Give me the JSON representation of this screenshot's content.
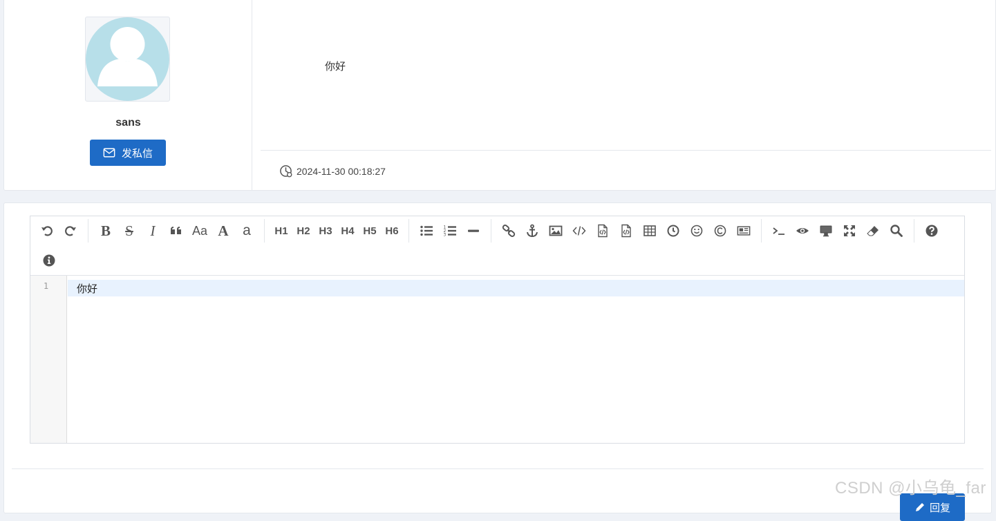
{
  "post": {
    "author": {
      "name": "sans",
      "avatar_icon": "default-user-avatar-icon"
    },
    "pm_button": {
      "label": "发私信",
      "icon": "envelope-icon"
    },
    "body": "你好",
    "timestamp": "2024-11-30 00:18:27"
  },
  "editor": {
    "toolbar": {
      "row1": [
        {
          "id": "undo",
          "icon": "undo-icon"
        },
        {
          "id": "redo",
          "icon": "redo-icon"
        },
        {
          "sep": true
        },
        {
          "id": "bold",
          "text": "B"
        },
        {
          "id": "strikethrough",
          "text": "S"
        },
        {
          "id": "italic",
          "text": "I"
        },
        {
          "id": "quote",
          "icon": "quote-icon"
        },
        {
          "id": "uppercase",
          "text": "Aa"
        },
        {
          "id": "capitalize",
          "text": "A"
        },
        {
          "id": "lowercase",
          "text": "a"
        },
        {
          "sep": true
        },
        {
          "id": "h1",
          "text": "H1"
        },
        {
          "id": "h2",
          "text": "H2"
        },
        {
          "id": "h3",
          "text": "H3"
        },
        {
          "id": "h4",
          "text": "H4"
        },
        {
          "id": "h5",
          "text": "H5"
        },
        {
          "id": "h6",
          "text": "H6"
        },
        {
          "sep": true
        },
        {
          "id": "unordered-list",
          "icon": "list-ul-icon"
        },
        {
          "id": "ordered-list",
          "icon": "list-ol-icon"
        },
        {
          "id": "horizontal-rule",
          "icon": "minus-icon"
        },
        {
          "sep": true
        },
        {
          "id": "link",
          "icon": "link-icon"
        },
        {
          "id": "anchor",
          "icon": "anchor-icon"
        },
        {
          "id": "image",
          "icon": "image-icon"
        },
        {
          "id": "inline-code",
          "icon": "code-icon"
        },
        {
          "id": "code-block",
          "icon": "file-code-icon"
        },
        {
          "id": "preformatted-text",
          "icon": "file-code-alt-icon"
        },
        {
          "id": "table",
          "icon": "table-icon"
        },
        {
          "id": "datetime",
          "icon": "clock-icon"
        },
        {
          "id": "emoji",
          "icon": "smile-icon"
        },
        {
          "id": "html-entities",
          "icon": "copyright-icon"
        },
        {
          "id": "pagebreak",
          "icon": "newspaper-icon"
        },
        {
          "sep": true
        },
        {
          "id": "goto-line",
          "icon": "terminal-icon"
        },
        {
          "id": "watch",
          "icon": "eye-icon"
        },
        {
          "id": "preview",
          "icon": "desktop-icon"
        },
        {
          "id": "fullscreen",
          "icon": "expand-icon"
        },
        {
          "id": "clear",
          "icon": "eraser-icon"
        },
        {
          "id": "search",
          "icon": "search-icon"
        },
        {
          "sep": true
        },
        {
          "id": "help",
          "icon": "question-circle-icon"
        }
      ],
      "row2": [
        {
          "id": "info",
          "icon": "info-circle-icon"
        }
      ]
    },
    "lines": [
      {
        "number": "1",
        "text": "你好"
      }
    ]
  },
  "submit_button": {
    "label": "回复",
    "icon": "send-icon"
  },
  "watermark": "CSDN @小乌龟_far",
  "colors": {
    "accent": "#1e6bc6",
    "page_bg": "#eff2f7",
    "avatar_bg": "#b7dfe9",
    "active_line": "#e8f2fe"
  }
}
